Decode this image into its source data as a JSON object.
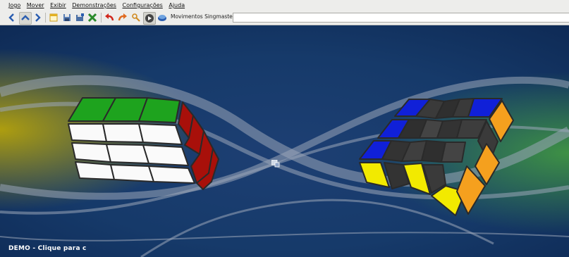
{
  "menu": [
    "Jogo",
    "Mover",
    "Exibir",
    "Demonstrações",
    "Configurações",
    "Ajuda"
  ],
  "toolbar": {
    "buttons": [
      {
        "icon": "back-arrow-icon",
        "color": "#2a5db0"
      },
      {
        "icon": "up-arrow-icon",
        "color": "#2a5db0"
      },
      {
        "icon": "forward-arrow-icon",
        "color": "#2a5db0"
      },
      {
        "icon": "new-game-icon",
        "color": "#e3b020"
      },
      {
        "icon": "save-icon",
        "color": "#4a6fa5"
      },
      {
        "icon": "save-as-icon",
        "color": "#4a6fa5"
      },
      {
        "icon": "scramble-icon",
        "color": "#2a8a2a"
      },
      {
        "icon": "undo-icon",
        "color": "#d0261c"
      },
      {
        "icon": "redo-icon",
        "color": "#e06a20"
      },
      {
        "icon": "search-icon",
        "color": "#d08a20"
      },
      {
        "icon": "play-icon",
        "color": "#222222"
      },
      {
        "icon": "stop-icon",
        "color": "#2a5db0"
      }
    ],
    "moves_label": "Movimentos Singmaster",
    "moves_value": ""
  },
  "status": "DEMO - Clique para c",
  "colors": {
    "green": "#1ea31e",
    "white": "#fafafa",
    "red": "#a8100a",
    "blue": "#1020d8",
    "yellow": "#f2ea00",
    "orange": "#f5a01e",
    "dark": "#3a3a3a"
  }
}
